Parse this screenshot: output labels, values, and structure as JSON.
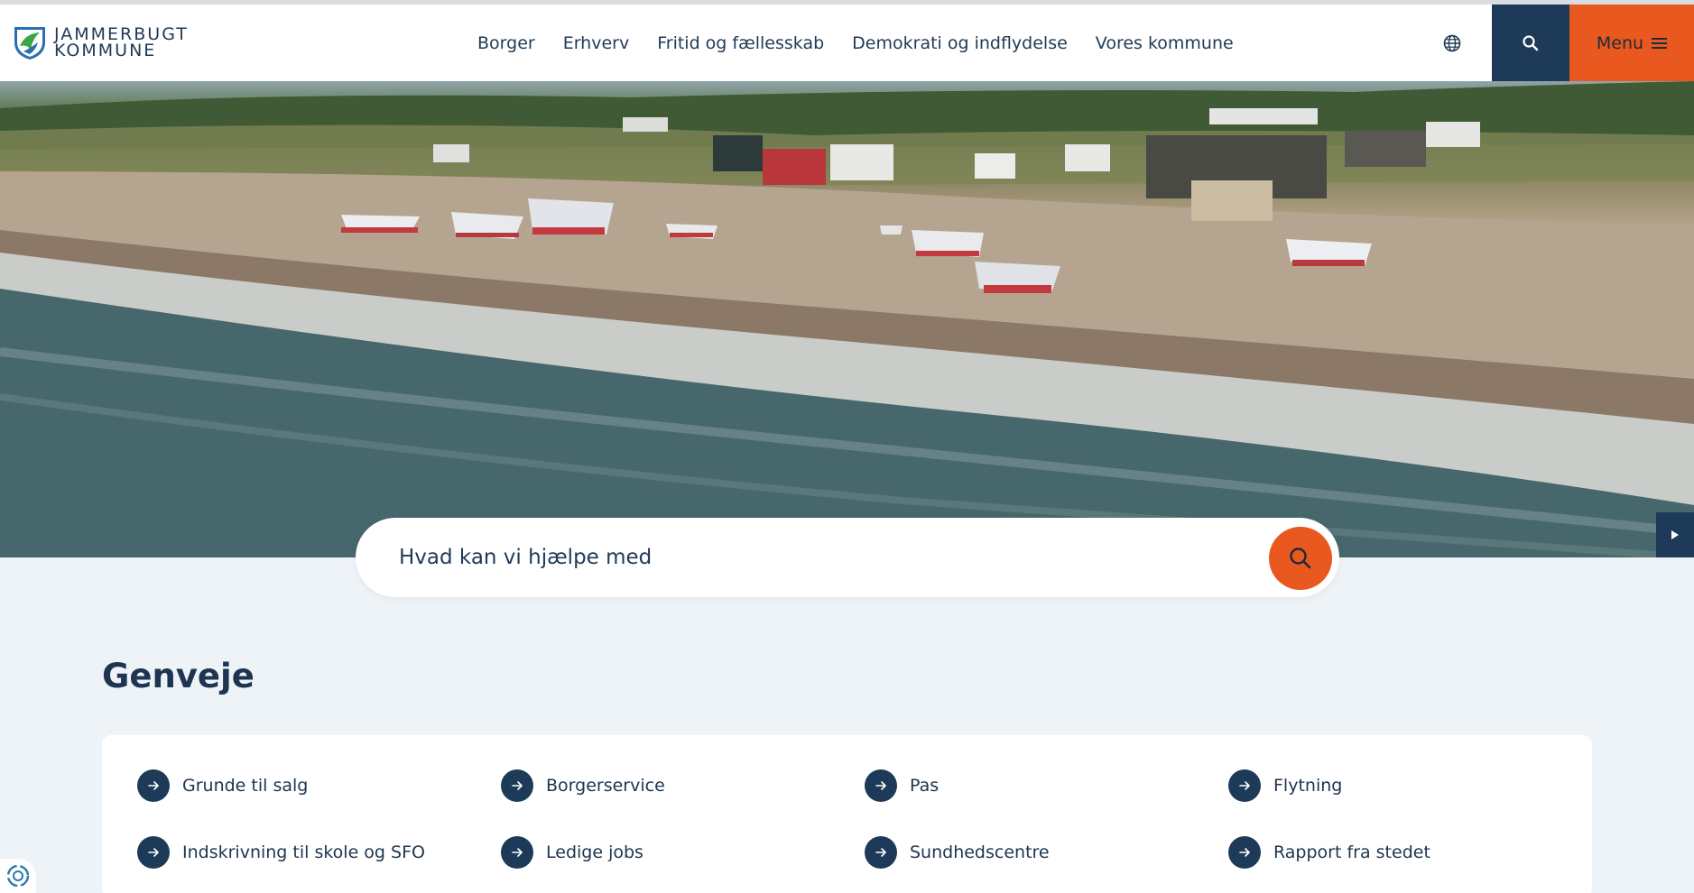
{
  "brand": {
    "line1": "JAMMERBUGT",
    "line2": "KOMMUNE",
    "colors": {
      "navy": "#1d3a58",
      "orange": "#e8581f",
      "logo_green": "#3aa645",
      "logo_blue": "#2b6fb3"
    }
  },
  "nav": {
    "items": [
      "Borger",
      "Erhverv",
      "Fritid og fællesskab",
      "Demokrati og indflydelse",
      "Vores kommune"
    ]
  },
  "header": {
    "language_icon": "globe-icon",
    "search_icon": "search-icon",
    "menu_label": "Menu",
    "menu_icon": "hamburger-icon"
  },
  "search": {
    "placeholder": "Hvad kan vi hjælpe med",
    "button_icon": "search-icon"
  },
  "hero": {
    "video_icon": "play-icon"
  },
  "shortcuts": {
    "title": "Genveje",
    "items": [
      {
        "label": "Grunde til salg"
      },
      {
        "label": "Borgerservice"
      },
      {
        "label": "Pas"
      },
      {
        "label": "Flytning"
      },
      {
        "label": "Indskrivning til skole og SFO"
      },
      {
        "label": "Ledige jobs"
      },
      {
        "label": "Sundhedscentre"
      },
      {
        "label": "Rapport fra stedet"
      }
    ]
  },
  "accessibility": {
    "icon": "accessibility-icon"
  }
}
